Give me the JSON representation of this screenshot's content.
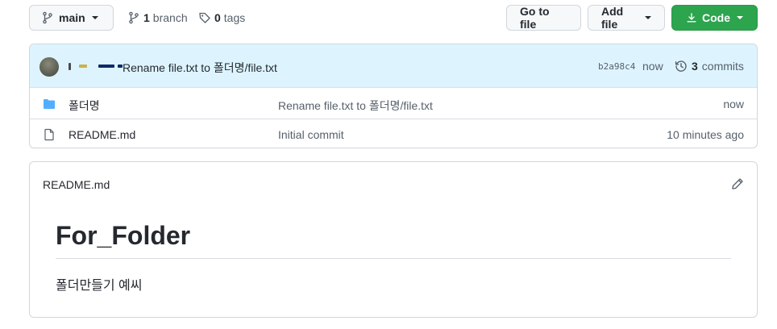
{
  "toolbar": {
    "branch_label": "main",
    "branches_count": "1",
    "branches_label": "branch",
    "tags_count": "0",
    "tags_label": "tags",
    "goto_file_label": "Go to file",
    "add_file_label": "Add file",
    "code_label": "Code"
  },
  "latest_commit": {
    "author": "",
    "message": "Rename file.txt to 폴더명/file.txt",
    "sha": "b2a98c4",
    "time": "now",
    "commits_count": "3",
    "commits_label": "commits"
  },
  "files": [
    {
      "name": "폴더명",
      "type": "folder",
      "commit_message": "Rename file.txt to 폴더명/file.txt",
      "age": "now"
    },
    {
      "name": "README.md",
      "type": "file",
      "commit_message": "Initial commit",
      "age": "10 minutes ago"
    }
  ],
  "readme": {
    "filename": "README.md",
    "heading": "For_Folder",
    "body": "폴더만들기 예씨"
  },
  "colors": {
    "primary_green": "#2da44e",
    "commit_bg": "#ddf4ff",
    "folder_blue": "#54aeff"
  },
  "icons": {
    "branch": "git-branch-icon",
    "tag": "tag-icon",
    "download": "download-icon",
    "history": "history-icon",
    "folder": "folder-icon",
    "file": "file-icon",
    "edit": "pencil-icon"
  }
}
